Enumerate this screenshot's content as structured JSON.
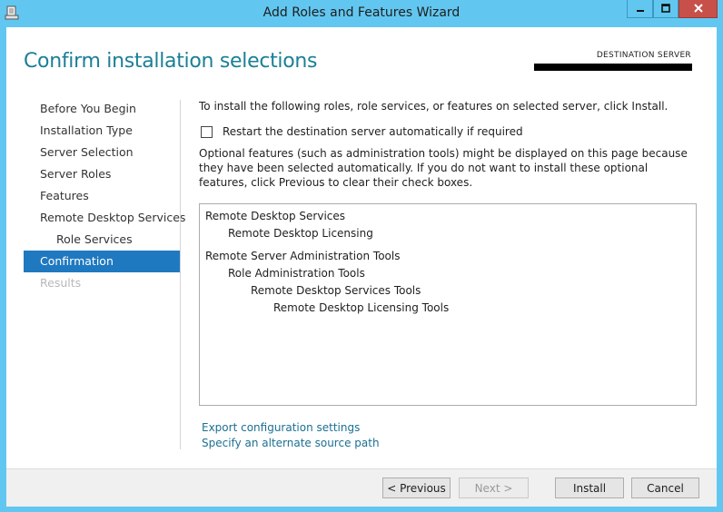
{
  "window": {
    "title": "Add Roles and Features Wizard",
    "icons": [
      "wizard-app-icon",
      "minimize-icon",
      "maximize-icon",
      "close-icon"
    ]
  },
  "header": {
    "page_title": "Confirm installation selections",
    "destination_label": "DESTINATION SERVER"
  },
  "nav": {
    "items": [
      {
        "label": "Before You Begin"
      },
      {
        "label": "Installation Type"
      },
      {
        "label": "Server Selection"
      },
      {
        "label": "Server Roles"
      },
      {
        "label": "Features"
      },
      {
        "label": "Remote Desktop Services"
      },
      {
        "label": "Role Services"
      },
      {
        "label": "Confirmation"
      },
      {
        "label": "Results"
      }
    ]
  },
  "content": {
    "intro": "To install the following roles, role services, or features on selected server, click Install.",
    "restart_label": "Restart the destination server automatically if required",
    "restart_checked": false,
    "optional_note": "Optional features (such as administration tools) might be displayed on this page because they have been selected automatically. If you do not want to install these optional features, click Previous to clear their check boxes.",
    "selections": [
      {
        "label": "Remote Desktop Services"
      },
      {
        "label": "Remote Desktop Licensing"
      },
      {
        "label": "Remote Server Administration Tools"
      },
      {
        "label": "Role Administration Tools"
      },
      {
        "label": "Remote Desktop Services Tools"
      },
      {
        "label": "Remote Desktop Licensing Tools"
      }
    ],
    "export_link": "Export configuration settings",
    "source_link": "Specify an alternate source path"
  },
  "footer": {
    "previous": "< Previous",
    "next": "Next >",
    "install": "Install",
    "cancel": "Cancel"
  },
  "colors": {
    "frame": "#62c7f0",
    "title_accent": "#1a7f96",
    "nav_active": "#1f79c0",
    "link": "#1b6f93"
  }
}
